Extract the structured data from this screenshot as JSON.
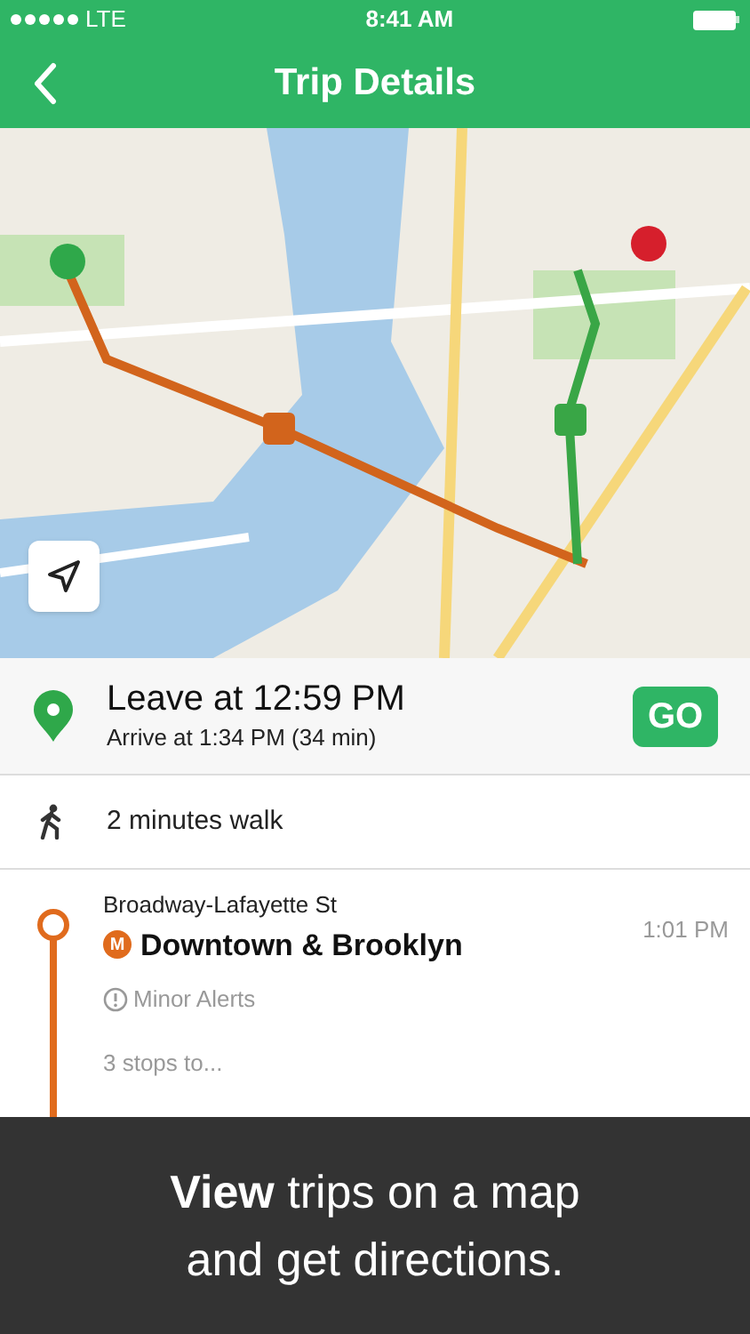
{
  "status_bar": {
    "carrier": "LTE",
    "time": "8:41 AM"
  },
  "nav": {
    "title": "Trip Details"
  },
  "departure": {
    "leave": "Leave at 12:59 PM",
    "arrive": "Arrive at 1:34 PM (34 min)",
    "go_button": "GO"
  },
  "steps": [
    {
      "kind": "walk",
      "text": "2 minutes walk"
    },
    {
      "kind": "transit",
      "color": "#e06b1d",
      "station": "Broadway-Lafayette St",
      "line_badge": "M",
      "direction": "Downtown & Brooklyn",
      "time": "1:01 PM",
      "alert": "Minor Alerts",
      "stops": "3 stops to..."
    }
  ],
  "banner": {
    "text": "**View** trips on a map\nand get directions."
  }
}
